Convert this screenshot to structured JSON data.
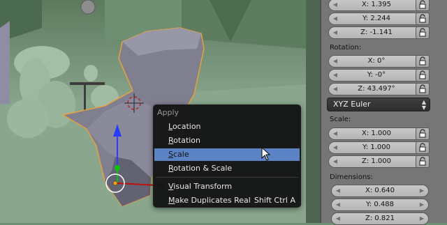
{
  "location": {
    "x": "X: 1.395",
    "y": "Y: 2.244",
    "z": "Z: -1.141"
  },
  "rotation": {
    "label": "Rotation:",
    "x": "X: 0°",
    "y": "Y: -0°",
    "z": "Z: 43.497°",
    "mode": "XYZ Euler"
  },
  "scale": {
    "label": "Scale:",
    "x": "X: 1.000",
    "y": "Y: 1.000",
    "z": "Z: 1.000"
  },
  "dimensions": {
    "label": "Dimensions:",
    "x": "X: 0.640",
    "y": "Y: 0.488",
    "z": "Z: 0.821"
  },
  "apply_menu": {
    "title": "Apply",
    "items": [
      {
        "label": "Location",
        "underline": "L",
        "rest": "ocation"
      },
      {
        "label": "Rotation",
        "underline": "R",
        "rest": "otation"
      },
      {
        "label": "Scale",
        "underline": "S",
        "rest": "cale"
      },
      {
        "label": "Rotation & Scale",
        "underline": "R",
        "rest": "otation & Scale"
      },
      {
        "label": "Visual Transform",
        "underline": "V",
        "rest": "isual Transform"
      },
      {
        "label": "Make Duplicates Real",
        "underline": "M",
        "rest": "ake Duplicates Real",
        "shortcut": "Shift Ctrl A"
      }
    ],
    "active_index": 2
  },
  "colors": {
    "menu_highlight": "#5c84c4",
    "selection_outline": "#e8a040",
    "axis_z": "#2a3cff",
    "axis_y": "#10c010",
    "axis_x": "#c01010"
  }
}
